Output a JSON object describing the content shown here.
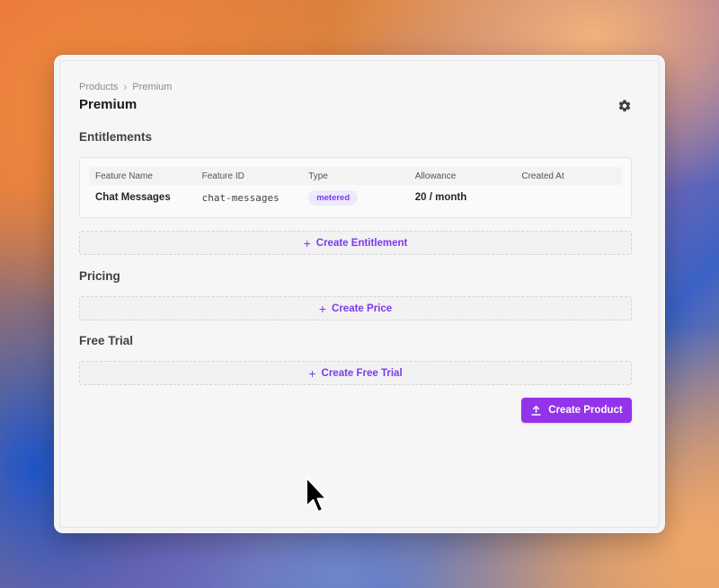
{
  "breadcrumb": {
    "parent": "Products",
    "separator": "›",
    "current": "Premium"
  },
  "page": {
    "title": "Premium",
    "settings_icon": "gear-icon"
  },
  "entitlements": {
    "title": "Entitlements",
    "columns": [
      "Feature Name",
      "Feature ID",
      "Type",
      "Allowance",
      "Created At"
    ],
    "rows": [
      {
        "feature_name": "Chat Messages",
        "feature_id": "chat-messages",
        "type": "metered",
        "allowance": "20 / month",
        "created_at": ""
      }
    ],
    "create_label": "Create Entitlement"
  },
  "pricing": {
    "title": "Pricing",
    "create_label": "Create Price"
  },
  "free_trial": {
    "title": "Free Trial",
    "create_label": "Create Free Trial"
  },
  "actions": {
    "create_product_label": "Create Product",
    "create_product_icon": "upload-icon"
  },
  "colors": {
    "accent": "#7c3aed",
    "primary_button": "#9333ea",
    "badge_bg": "#ede9fe"
  }
}
